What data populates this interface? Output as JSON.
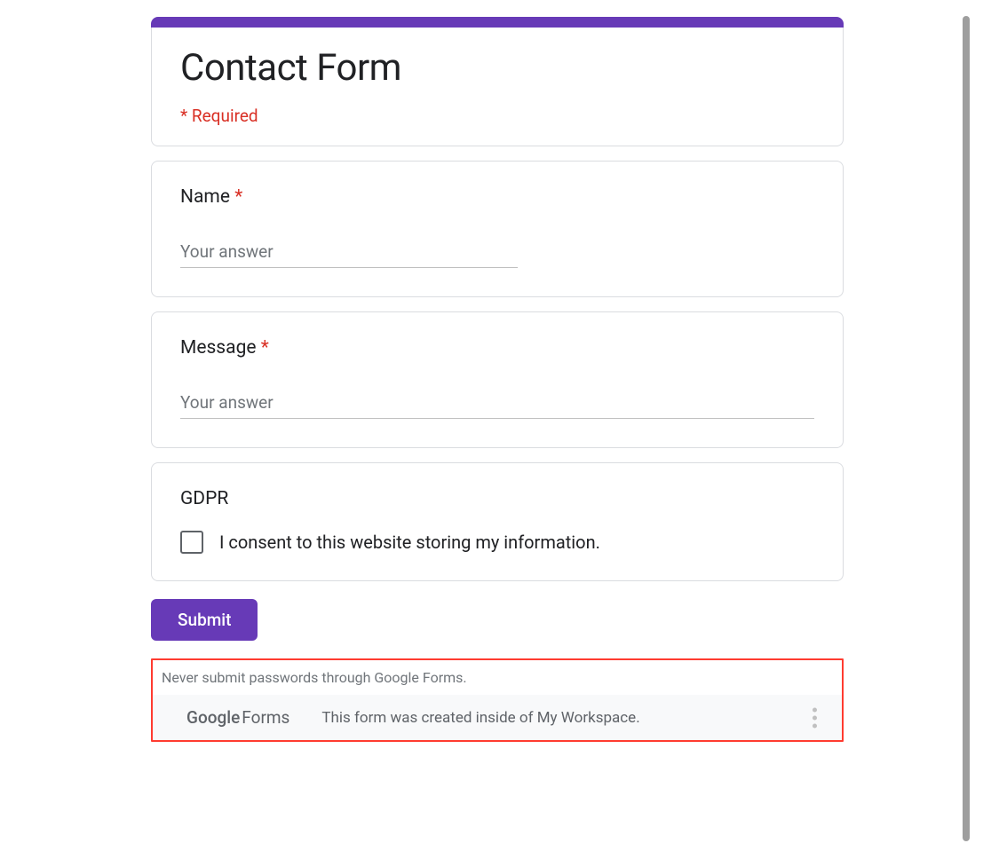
{
  "header": {
    "title": "Contact Form",
    "required_note": "* Required"
  },
  "questions": {
    "name": {
      "label": "Name",
      "required_star": "*",
      "placeholder": "Your answer"
    },
    "message": {
      "label": "Message",
      "required_star": "*",
      "placeholder": "Your answer"
    },
    "gdpr": {
      "label": "GDPR",
      "checkbox_label": "I consent to this website storing my information."
    }
  },
  "submit_label": "Submit",
  "footer": {
    "warning": "Never submit passwords through Google Forms.",
    "logo_part1": "Google",
    "logo_part2": "Forms",
    "workspace_text": "This form was created inside of My Workspace."
  },
  "colors": {
    "accent": "#673ab7",
    "required": "#d93025"
  }
}
